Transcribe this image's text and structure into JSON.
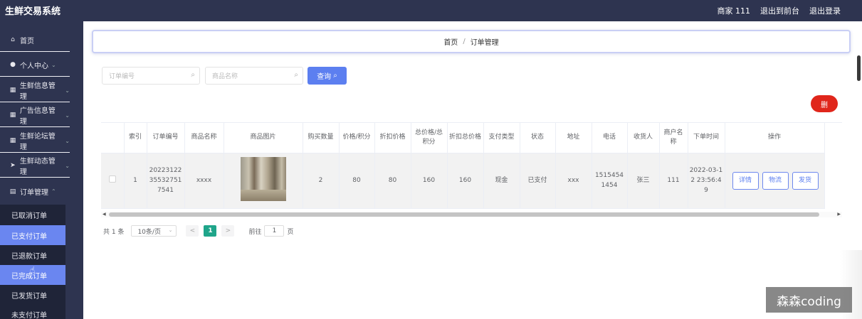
{
  "header": {
    "app_title": "生鲜交易系统",
    "user_label": "商家 111",
    "exit_frontend": "退出到前台",
    "logout": "退出登录"
  },
  "sidebar": {
    "items": [
      {
        "label": "首页",
        "icon": "home-icon",
        "has_children": false
      },
      {
        "label": "个人中心",
        "icon": "user-icon",
        "has_children": true
      },
      {
        "label": "生鲜信息管理",
        "icon": "grid-icon",
        "has_children": true
      },
      {
        "label": "广告信息管理",
        "icon": "grid-icon",
        "has_children": true
      },
      {
        "label": "生鲜论坛管理",
        "icon": "grid-icon",
        "has_children": true
      },
      {
        "label": "生鲜动态管理",
        "icon": "send-icon",
        "has_children": true
      },
      {
        "label": "订单管理",
        "icon": "list-icon",
        "has_children": true
      }
    ],
    "sub_items": [
      {
        "label": "已取消订单",
        "active": false
      },
      {
        "label": "已支付订单",
        "active": true
      },
      {
        "label": "已退款订单",
        "active": false
      },
      {
        "label": "已完成订单",
        "active": true
      },
      {
        "label": "已发货订单",
        "active": false
      },
      {
        "label": "未支付订单",
        "active": false
      }
    ]
  },
  "breadcrumb": {
    "home": "首页",
    "separator": "/",
    "current": "订单管理"
  },
  "search": {
    "order_no_placeholder": "订单编号",
    "product_name_placeholder": "商品名称",
    "query_label": "查询"
  },
  "actions": {
    "delete_label": "删"
  },
  "table": {
    "headers": [
      "",
      "索引",
      "订单编号",
      "商品名称",
      "商品图片",
      "购买数量",
      "价格/积分",
      "折扣价格",
      "总价格/总积分",
      "折扣总价格",
      "支付类型",
      "状态",
      "地址",
      "电话",
      "收货人",
      "商户名称",
      "下单时间",
      "操作"
    ],
    "rows": [
      {
        "index": "1",
        "order_no": "20223122355327517541",
        "product_name": "xxxx",
        "quantity": "2",
        "price": "80",
        "discount_price": "80",
        "total_price": "160",
        "discount_total": "160",
        "pay_type": "现金",
        "status": "已支付",
        "address": "xxx",
        "phone": "15154541454",
        "receiver": "张三",
        "merchant": "111",
        "order_time": "2022-03-12 23:56:49",
        "op_detail": "详情",
        "op_logistics": "物流",
        "op_ship": "发货"
      }
    ]
  },
  "pagination": {
    "total": "共 1 条",
    "page_size": "10条/页",
    "prev": "<",
    "current_page": "1",
    "next": ">",
    "goto_prefix": "前往",
    "goto_value": "1",
    "goto_suffix": "页"
  },
  "watermark": {
    "text": "森森coding"
  },
  "colors": {
    "sidebar_bg": "#2e3450",
    "primary": "#5c7ff0",
    "danger": "#e0261b",
    "pagination_active": "#1fa58a"
  }
}
